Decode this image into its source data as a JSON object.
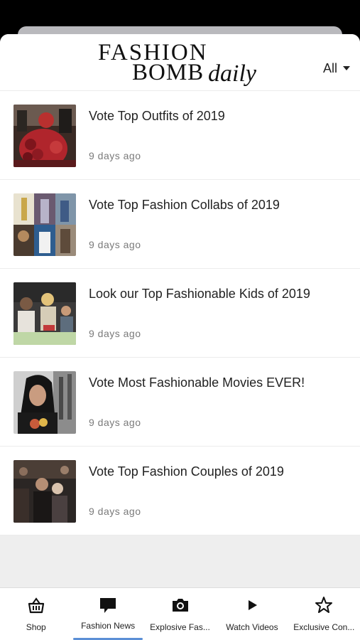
{
  "header": {
    "logo_line1": "FASHION",
    "logo_line2": "BOMB",
    "logo_daily": "daily",
    "filter_label": "All"
  },
  "articles": [
    {
      "title": "Vote Top Outfits of 2019",
      "time": "9 days ago"
    },
    {
      "title": "Vote Top Fashion Collabs of 2019",
      "time": "9 days ago"
    },
    {
      "title": "Look our Top Fashionable Kids of 2019",
      "time": "9 days ago"
    },
    {
      "title": "Vote Most Fashionable Movies EVER!",
      "time": "9 days ago"
    },
    {
      "title": "Vote Top Fashion Couples of 2019",
      "time": "9 days ago"
    }
  ],
  "tabs": [
    {
      "label": "Shop",
      "icon": "shopping-basket-icon",
      "active": false
    },
    {
      "label": "Fashion News",
      "icon": "chat-bubble-icon",
      "active": true
    },
    {
      "label": "Explosive Fas...",
      "icon": "camera-icon",
      "active": false
    },
    {
      "label": "Watch Videos",
      "icon": "play-icon",
      "active": false
    },
    {
      "label": "Exclusive Con...",
      "icon": "star-icon",
      "active": false
    }
  ],
  "colors": {
    "active_tab_indicator": "#5b8fd6",
    "background": "#000000",
    "filler": "#eeeeee"
  }
}
